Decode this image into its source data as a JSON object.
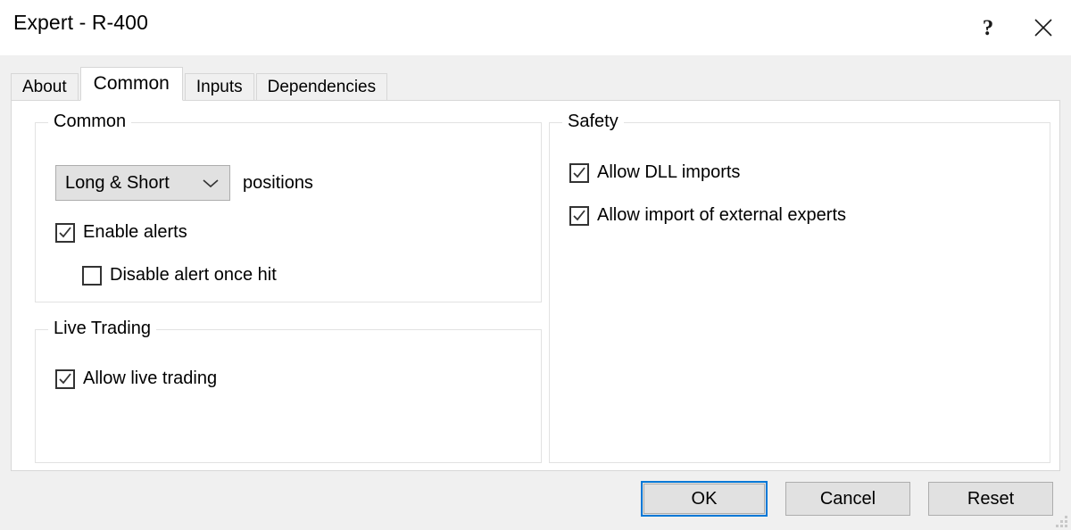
{
  "window": {
    "title": "Expert - R-400",
    "help_button": "?",
    "close_button": "✕"
  },
  "tabs": [
    {
      "label": "About",
      "active": false
    },
    {
      "label": "Common",
      "active": true
    },
    {
      "label": "Inputs",
      "active": false
    },
    {
      "label": "Dependencies",
      "active": false
    }
  ],
  "common_group": {
    "title": "Common",
    "positions_combo": {
      "value": "Long & Short",
      "side_label": "positions",
      "arrow_icon": "chevron-down-icon",
      "options": [
        "Long & Short"
      ]
    },
    "enable_alerts": {
      "label": "Enable alerts",
      "checked": true
    },
    "disable_alert_once_hit": {
      "label": "Disable alert once hit",
      "checked": false
    }
  },
  "live_trading_group": {
    "title": "Live Trading",
    "allow_live_trading": {
      "label": "Allow live trading",
      "checked": true
    }
  },
  "safety_group": {
    "title": "Safety",
    "allow_dll_imports": {
      "label": "Allow DLL imports",
      "checked": true
    },
    "allow_external_experts": {
      "label": "Allow import of external experts",
      "checked": true
    }
  },
  "footer": {
    "ok": "OK",
    "cancel": "Cancel",
    "reset": "Reset"
  },
  "colors": {
    "accent": "#0078d7",
    "dialog_background": "#f0f0f0",
    "panel_background": "#ffffff",
    "control_face": "#e1e1e1",
    "border": "#adadad",
    "group_border": "#e2e2e2"
  }
}
